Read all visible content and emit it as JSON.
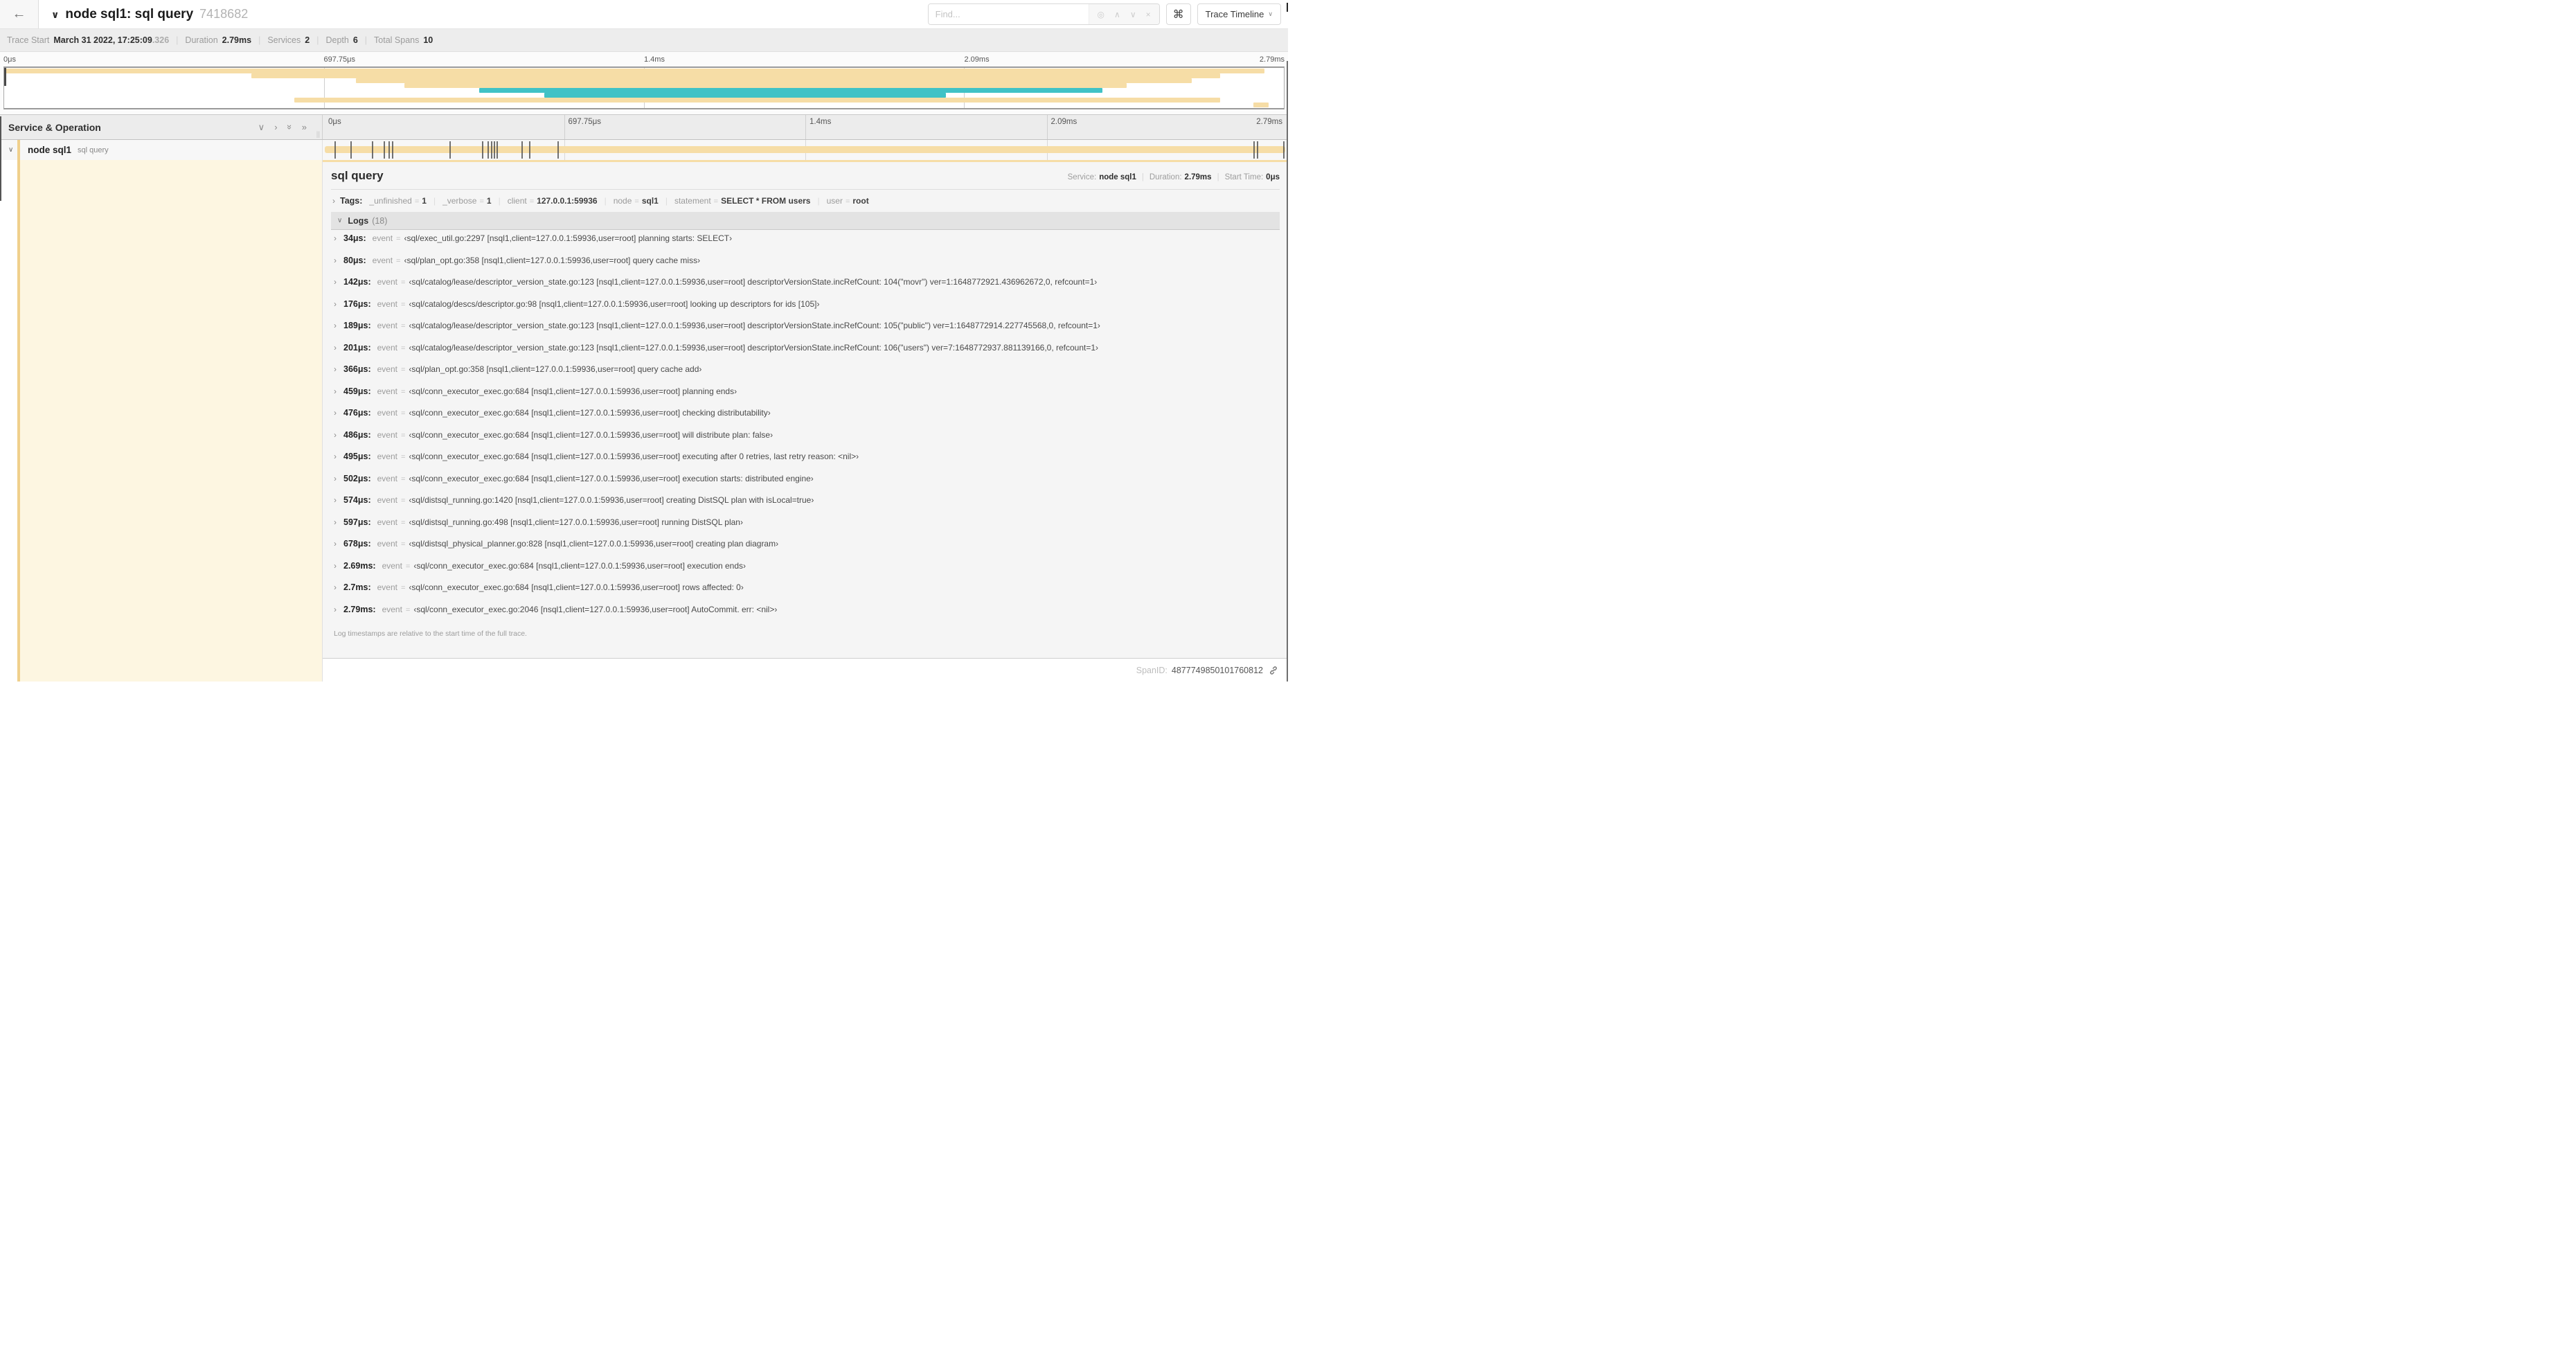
{
  "header": {
    "back_icon": "←",
    "collapse_icon": "∨",
    "title": "node sql1: sql query",
    "trace_id": "7418682",
    "find_placeholder": "Find...",
    "locate_icon": "◎",
    "prev_icon": "∧",
    "next_icon": "∨",
    "clear_icon": "×",
    "shortcut_icon": "⌘",
    "view_selector": "Trace Timeline",
    "view_caret": "∨"
  },
  "summary": {
    "items": [
      {
        "label": "Trace Start",
        "value": "March 31 2022, 17:25:09",
        "suffix": ".326"
      },
      {
        "label": "Duration",
        "value": "2.79ms",
        "suffix": ""
      },
      {
        "label": "Services",
        "value": "2",
        "suffix": ""
      },
      {
        "label": "Depth",
        "value": "6",
        "suffix": ""
      },
      {
        "label": "Total Spans",
        "value": "10",
        "suffix": ""
      }
    ]
  },
  "minimap": {
    "ticks": [
      "0μs",
      "697.75μs",
      "1.4ms",
      "2.09ms",
      "2.79ms"
    ],
    "bars": [
      {
        "color": "tan",
        "left": 0,
        "width": 98.5
      },
      {
        "color": "tan",
        "left": 19.3,
        "width": 75.7
      },
      {
        "color": "tan",
        "left": 27.5,
        "width": 65.3
      },
      {
        "color": "tan",
        "left": 31.3,
        "width": 56.4
      },
      {
        "color": "teal",
        "left": 37.1,
        "width": 48.7
      },
      {
        "color": "teal",
        "left": 42.2,
        "width": 31.4
      },
      {
        "color": "tan",
        "left": 22.7,
        "width": 72.3
      },
      {
        "color": "tan",
        "left": 97.6,
        "width": 1.2
      }
    ],
    "colors": {
      "tan": "#f6dda6",
      "teal": "#40c2c6"
    }
  },
  "timeline": {
    "left_header": "Service & Operation",
    "collapse_one_icon": "∨",
    "expand_one_icon": "›",
    "collapse_all_icon": "»",
    "expand_all_icon": "»",
    "resizer_icon": "||",
    "ticks": [
      "0μs",
      "697.75μs",
      "1.4ms",
      "2.09ms",
      "2.79ms"
    ],
    "span_row": {
      "chevron": "∨",
      "service": "node sql1",
      "operation": "sql query"
    }
  },
  "detail": {
    "operation": "sql query",
    "service_label": "Service:",
    "service": "node sql1",
    "duration_label": "Duration:",
    "duration": "2.79ms",
    "start_label": "Start Time:",
    "start": "0μs",
    "tags_chevron": "›",
    "tags_label": "Tags:",
    "tags": [
      {
        "key": "_unfinished",
        "value": "1"
      },
      {
        "key": "_verbose",
        "value": "1"
      },
      {
        "key": "client",
        "value": "127.0.0.1:59936"
      },
      {
        "key": "node",
        "value": "sql1"
      },
      {
        "key": "statement",
        "value": "SELECT * FROM users"
      },
      {
        "key": "user",
        "value": "root"
      }
    ],
    "logs_chevron": "∨",
    "logs_label": "Logs",
    "logs_count": "(18)",
    "log_key": "event",
    "logs": [
      {
        "time": "34μs:",
        "pct": 1.2,
        "value": "‹sql/exec_util.go:2297 [nsql1,client=127.0.0.1:59936,user=root] planning starts: SELECT›"
      },
      {
        "time": "80μs:",
        "pct": 2.9,
        "value": "‹sql/plan_opt.go:358 [nsql1,client=127.0.0.1:59936,user=root] query cache miss›"
      },
      {
        "time": "142μs:",
        "pct": 5.1,
        "value": "‹sql/catalog/lease/descriptor_version_state.go:123 [nsql1,client=127.0.0.1:59936,user=root] descriptorVersionState.incRefCount: 104(\"movr\") ver=1:1648772921.436962672,0, refcount=1›"
      },
      {
        "time": "176μs:",
        "pct": 6.3,
        "value": "‹sql/catalog/descs/descriptor.go:98 [nsql1,client=127.0.0.1:59936,user=root] looking up descriptors for ids [105]›"
      },
      {
        "time": "189μs:",
        "pct": 6.8,
        "value": "‹sql/catalog/lease/descriptor_version_state.go:123 [nsql1,client=127.0.0.1:59936,user=root] descriptorVersionState.incRefCount: 105(\"public\") ver=1:1648772914.227745568,0, refcount=1›"
      },
      {
        "time": "201μs:",
        "pct": 7.2,
        "value": "‹sql/catalog/lease/descriptor_version_state.go:123 [nsql1,client=127.0.0.1:59936,user=root] descriptorVersionState.incRefCount: 106(\"users\") ver=7:1648772937.881139166,0, refcount=1›"
      },
      {
        "time": "366μs:",
        "pct": 13.1,
        "value": "‹sql/plan_opt.go:358 [nsql1,client=127.0.0.1:59936,user=root] query cache add›"
      },
      {
        "time": "459μs:",
        "pct": 16.5,
        "value": "‹sql/conn_executor_exec.go:684 [nsql1,client=127.0.0.1:59936,user=root] planning ends›"
      },
      {
        "time": "476μs:",
        "pct": 17.1,
        "value": "‹sql/conn_executor_exec.go:684 [nsql1,client=127.0.0.1:59936,user=root] checking distributability›"
      },
      {
        "time": "486μs:",
        "pct": 17.4,
        "value": "‹sql/conn_executor_exec.go:684 [nsql1,client=127.0.0.1:59936,user=root] will distribute plan: false›"
      },
      {
        "time": "495μs:",
        "pct": 17.7,
        "value": "‹sql/conn_executor_exec.go:684 [nsql1,client=127.0.0.1:59936,user=root] executing after 0 retries, last retry reason: <nil>›"
      },
      {
        "time": "502μs:",
        "pct": 18.0,
        "value": "‹sql/conn_executor_exec.go:684 [nsql1,client=127.0.0.1:59936,user=root] execution starts: distributed engine›"
      },
      {
        "time": "574μs:",
        "pct": 20.6,
        "value": "‹sql/distsql_running.go:1420 [nsql1,client=127.0.0.1:59936,user=root] creating DistSQL plan with isLocal=true›"
      },
      {
        "time": "597μs:",
        "pct": 21.4,
        "value": "‹sql/distsql_running.go:498 [nsql1,client=127.0.0.1:59936,user=root] running DistSQL plan›"
      },
      {
        "time": "678μs:",
        "pct": 24.3,
        "value": "‹sql/distsql_physical_planner.go:828 [nsql1,client=127.0.0.1:59936,user=root] creating plan diagram›"
      },
      {
        "time": "2.69ms:",
        "pct": 96.4,
        "value": "‹sql/conn_executor_exec.go:684 [nsql1,client=127.0.0.1:59936,user=root] execution ends›"
      },
      {
        "time": "2.7ms:",
        "pct": 96.8,
        "value": "‹sql/conn_executor_exec.go:684 [nsql1,client=127.0.0.1:59936,user=root] rows affected: 0›"
      },
      {
        "time": "2.79ms:",
        "pct": 99.5,
        "value": "‹sql/conn_executor_exec.go:2046 [nsql1,client=127.0.0.1:59936,user=root] AutoCommit. err: <nil>›"
      }
    ],
    "note": "Log timestamps are relative to the start time of the full trace.",
    "span_id_label": "SpanID:",
    "span_id": "4877749850101760812"
  }
}
